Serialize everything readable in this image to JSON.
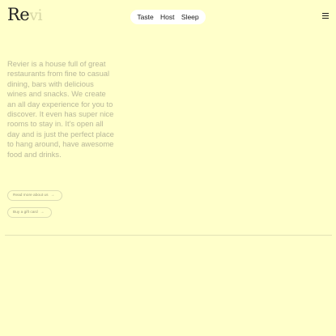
{
  "header": {
    "logo_text": "Re",
    "logo_ghost": "vi"
  },
  "nav": {
    "items": [
      {
        "label": "Taste"
      },
      {
        "label": "Host"
      },
      {
        "label": "Sleep"
      }
    ]
  },
  "menu": {
    "icon": "hamburger-icon"
  },
  "intro": {
    "text": "Revier is a house full of great restaurants from fine to casual dining, bars with delicious wines and snacks. We create an all day experience for you to discover. It even has super nice rooms to stay in. It's open all day and is just the perfect place to hang around, have awesome food and drinks."
  },
  "buttons": {
    "about_label": "Read more about us",
    "about_arrow": "→",
    "gift_label": "Buy a gift card",
    "gift_arrow": "→"
  },
  "colors": {
    "background": "#FFFFCA",
    "nav_pill": "#FFFFFF",
    "muted_text": "#B8B79A"
  }
}
